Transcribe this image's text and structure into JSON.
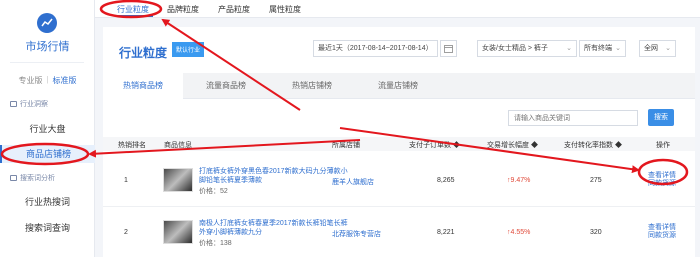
{
  "sidebar": {
    "title": "市场行情",
    "edition_pro": "专业版",
    "edition_std": "标准版",
    "section1": "行业洞察",
    "nav1": "行业大盘",
    "nav2": "商品店铺榜",
    "section2": "搜索词分析",
    "nav3": "行业热搜词",
    "nav4": "搜索词查询"
  },
  "top_tabs": [
    "行业粒度",
    "品牌粒度",
    "产品粒度",
    "属性粒度"
  ],
  "header": {
    "title": "行业粒度",
    "badge": "默认行业",
    "date_range": "最近1天（2017-08-14~2017-08-14）",
    "category": "女装/女士精品 > 裤子",
    "terminal": "所有终端",
    "region": "全网"
  },
  "content_tabs": [
    "热销商品榜",
    "流量商品榜",
    "热销店铺榜",
    "流量店铺榜"
  ],
  "search": {
    "placeholder": "请输入商品关键词",
    "button": "搜索"
  },
  "table": {
    "headers": [
      "热销排名",
      "商品信息",
      "所属店铺",
      "支付子订单数 ◆",
      "交易增长幅度 ◆",
      "支付转化率指数 ◆",
      "操作"
    ],
    "rows": [
      {
        "rank": "1",
        "name": "打底裤女裤外穿黑色春2017新款大码九分薄款小脚铅笔长裤夏季薄款",
        "price": "价格：52",
        "store": "鹿羊人旗舰店",
        "orders": "8,265",
        "growth": "↑9.47%",
        "conversion": "275",
        "op1": "查看详情",
        "op2": "同款货源"
      },
      {
        "rank": "2",
        "name": "南极人打底裤女裤春夏季2017新款长裤铅笔长裤外穿小脚裤薄款九分",
        "price": "价格：138",
        "store": "北荐服饰专营店",
        "orders": "8,221",
        "growth": "↑4.55%",
        "conversion": "320",
        "op1": "查看详情",
        "op2": "同款货源"
      }
    ]
  },
  "colors": {
    "accent": "#2f6fcf",
    "annotation": "#e3171e",
    "up": "#e04a3a"
  }
}
